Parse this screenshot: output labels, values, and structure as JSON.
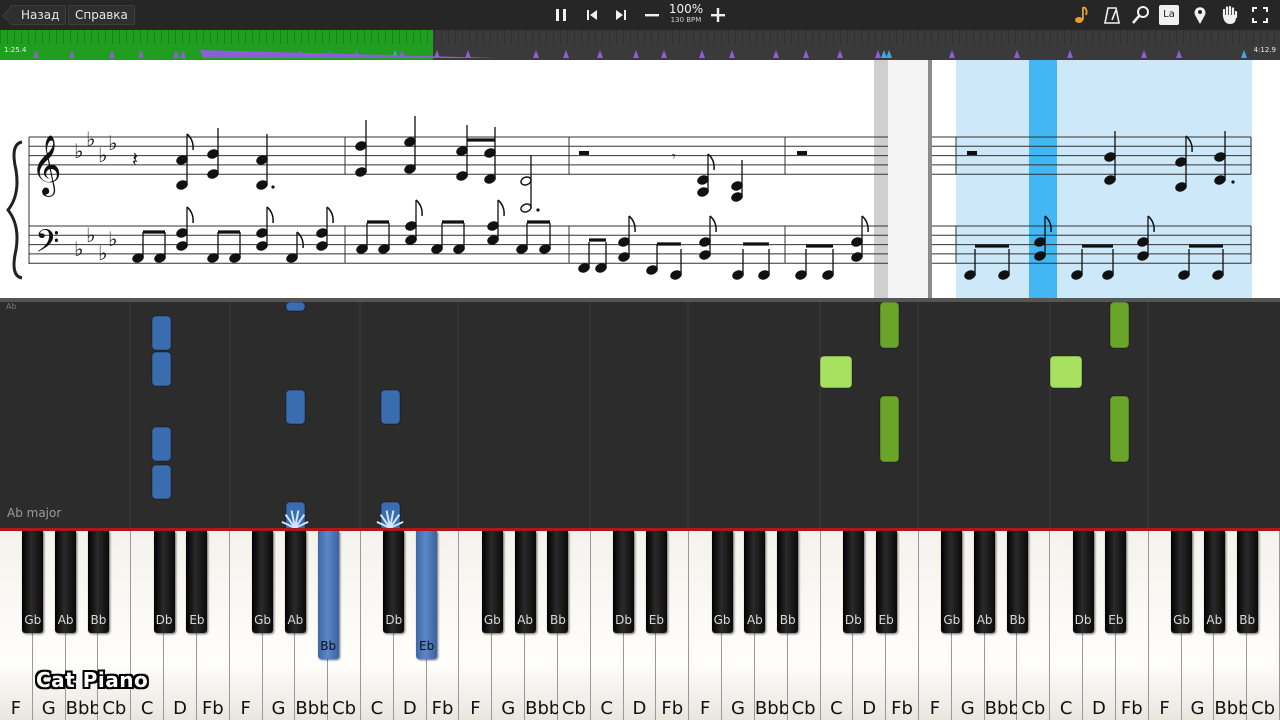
{
  "toolbar": {
    "back_label": "Назад",
    "help_label": "Справка",
    "tempo_percent": "100%",
    "tempo_bpm": "130 BPM",
    "icons_center": [
      "pause-icon",
      "previous-icon",
      "next-icon",
      "minus-icon",
      "plus-icon"
    ],
    "icons_right": [
      "note-icon",
      "metronome-icon",
      "magnifier-icon",
      "note-name-icon",
      "location-pin-icon",
      "hand-icon",
      "fullscreen-icon"
    ],
    "note_name_glyph": "La"
  },
  "timeline": {
    "start_time": "1:25.4",
    "end_time": "4:12.9",
    "progress": 0.338,
    "colors": {
      "progress": "#1f9e20",
      "marker_purple": "#8c5fd6",
      "marker_blue": "#3aa9e8"
    }
  },
  "piano_roll": {
    "key_signature": "Ab major",
    "top_label": "Ab",
    "colors": {
      "left_hand": "#3a6cb0",
      "right_hand": "#6aa52a",
      "right_hand_light": "#a8e060"
    }
  },
  "keyboard": {
    "white_keys": [
      "F",
      "G",
      "Bbb",
      "Cb",
      "C",
      "D",
      "Fb",
      "F",
      "G",
      "Bbb",
      "Cb",
      "C",
      "D",
      "Fb",
      "F",
      "G",
      "Bbb",
      "Cb",
      "C",
      "D",
      "Fb",
      "F",
      "G",
      "Bbb",
      "Cb",
      "C",
      "D",
      "Fb",
      "F",
      "G",
      "Bbb",
      "Cb",
      "C",
      "D",
      "Fb",
      "F",
      "G",
      "Bbb",
      "Cb"
    ],
    "black_keys": [
      "Gb",
      "Ab",
      "Bb",
      "Db",
      "Eb",
      "Gb",
      "Ab",
      "Bb",
      "Db",
      "Eb",
      "Gb",
      "Ab",
      "Bb",
      "Db",
      "Eb",
      "Gb",
      "Ab",
      "Bb",
      "Db",
      "Eb",
      "Gb",
      "Ab",
      "Bb",
      "Db",
      "Eb",
      "Gb",
      "Ab",
      "Bb",
      "Db",
      "Eb",
      "Gb",
      "Ab",
      "Bb"
    ],
    "pressed_black_keys": [
      "Ab",
      "Db"
    ]
  },
  "watermark": "Cat Piano"
}
